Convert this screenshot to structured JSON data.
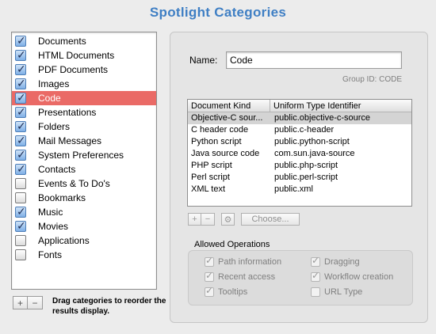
{
  "title": "Spotlight Categories",
  "categories": [
    {
      "label": "Documents",
      "checked": true
    },
    {
      "label": "HTML Documents",
      "checked": true
    },
    {
      "label": "PDF Documents",
      "checked": true
    },
    {
      "label": "Images",
      "checked": true
    },
    {
      "label": "Code",
      "checked": true,
      "selected": true
    },
    {
      "label": "Presentations",
      "checked": true
    },
    {
      "label": "Folders",
      "checked": true
    },
    {
      "label": "Mail Messages",
      "checked": true
    },
    {
      "label": "System Preferences",
      "checked": true
    },
    {
      "label": "Contacts",
      "checked": true
    },
    {
      "label": "Events & To Do's",
      "checked": false
    },
    {
      "label": "Bookmarks",
      "checked": false
    },
    {
      "label": "Music",
      "checked": true
    },
    {
      "label": "Movies",
      "checked": true
    },
    {
      "label": "Applications",
      "checked": false
    },
    {
      "label": "Fonts",
      "checked": false
    }
  ],
  "list_buttons": {
    "add": "+",
    "remove": "−"
  },
  "drag_hint": "Drag categories to reorder the results display.",
  "detail": {
    "name_label": "Name:",
    "name_value": "Code",
    "group_id": "Group ID: CODE",
    "table": {
      "headers": [
        "Document Kind",
        "Uniform Type Identifier"
      ],
      "rows": [
        [
          "Objective-C sour...",
          "public.objective-c-source"
        ],
        [
          "C header code",
          "public.c-header"
        ],
        [
          "Python script",
          "public.python-script"
        ],
        [
          "Java source code",
          "com.sun.java-source"
        ],
        [
          "PHP script",
          "public.php-script"
        ],
        [
          "Perl script",
          "public.perl-script"
        ],
        [
          "XML text",
          "public.xml"
        ]
      ],
      "selected_row": 0
    },
    "table_buttons": {
      "add": "+",
      "remove": "−",
      "gear": "⚙",
      "choose": "Choose..."
    },
    "ops_label": "Allowed Operations",
    "operations": [
      {
        "label": "Path information",
        "checked": true
      },
      {
        "label": "Dragging",
        "checked": true
      },
      {
        "label": "Recent access",
        "checked": true
      },
      {
        "label": "Workflow creation",
        "checked": true
      },
      {
        "label": "Tooltips",
        "checked": true
      },
      {
        "label": "URL Type",
        "checked": false
      }
    ]
  },
  "colors": {
    "title": "#3f7fc4",
    "selection": "#ea6a66"
  }
}
